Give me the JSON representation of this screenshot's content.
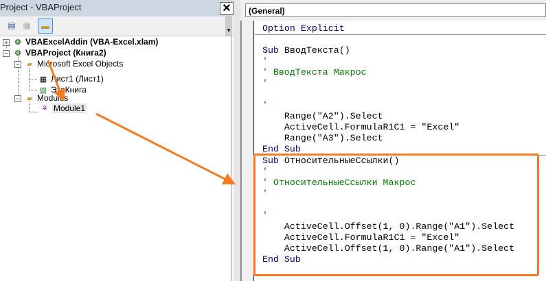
{
  "project_window": {
    "title": "Project - VBAProject",
    "close": "✕"
  },
  "toolbar": {
    "view_code": "view-code",
    "view_object": "view-object",
    "toggle_folders": "toggle-folders"
  },
  "tree": {
    "addin": "VBAExcelAddin (VBA-Excel.xlam)",
    "project": "VBAProject (Книга2)",
    "excel_objects": "Microsoft Excel Objects",
    "sheet1": "Лист1 (Лист1)",
    "thisworkbook": "ЭтаКнига",
    "modules": "Modules",
    "module1": "Module1"
  },
  "combo": {
    "value": "(General)"
  },
  "code": [
    [
      [
        "kw",
        "Option Explicit"
      ]
    ],
    [],
    [
      [
        "kw",
        "Sub"
      ],
      [
        "",
        "ВводТекста()"
      ]
    ],
    [
      [
        "cm",
        "'"
      ]
    ],
    [
      [
        "cm",
        "' ВводТекста Макрос"
      ]
    ],
    [
      [
        "cm",
        "'"
      ]
    ],
    [],
    [
      [
        "cm",
        "'"
      ]
    ],
    [
      [
        "",
        "    Range(\"A2\").Select"
      ]
    ],
    [
      [
        "",
        "    ActiveCell.FormulaR1C1 = \"Excel\""
      ]
    ],
    [
      [
        "",
        "    Range(\"A3\").Select"
      ]
    ],
    [
      [
        "kw",
        "End Sub"
      ]
    ],
    [
      [
        "kw",
        "Sub"
      ],
      [
        "",
        "ОтносительныеСсылки()"
      ]
    ],
    [
      [
        "cm",
        "'"
      ]
    ],
    [
      [
        "cm",
        "' ОтносительныеСсылки Макрос"
      ]
    ],
    [
      [
        "cm",
        "'"
      ]
    ],
    [],
    [
      [
        "cm",
        "'"
      ]
    ],
    [
      [
        "",
        "    ActiveCell.Offset(1, 0).Range(\"A1\").Select"
      ]
    ],
    [
      [
        "",
        "    ActiveCell.FormulaR1C1 = \"Excel\""
      ]
    ],
    [
      [
        "",
        "    ActiveCell.Offset(1, 0).Range(\"A1\").Select"
      ]
    ],
    [
      [
        "kw",
        "End Sub"
      ]
    ]
  ],
  "colors": {
    "highlight": "#f47b20",
    "keyword": "#00007f",
    "comment": "#008000"
  }
}
